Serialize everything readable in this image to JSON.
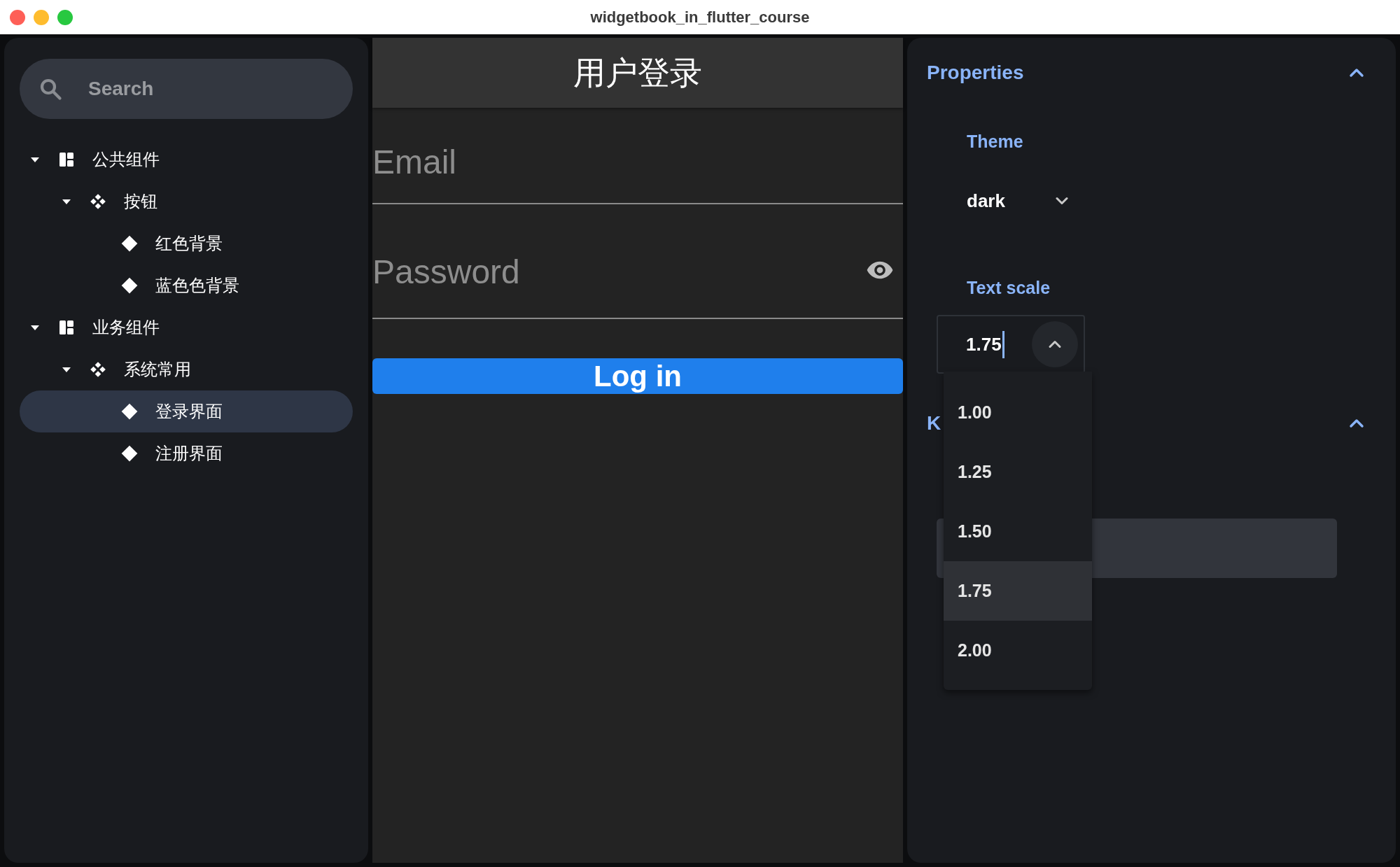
{
  "window": {
    "title": "widgetbook_in_flutter_course"
  },
  "sidebar": {
    "search": {
      "placeholder": "Search"
    },
    "tree": [
      {
        "label": "公共组件",
        "kind": "category",
        "expanded": true,
        "selected": false,
        "children": [
          {
            "label": "按钮",
            "kind": "component",
            "expanded": true,
            "selected": false,
            "children": [
              {
                "label": "红色背景",
                "kind": "use_case",
                "selected": false
              },
              {
                "label": "蓝色色背景",
                "kind": "use_case",
                "selected": false
              }
            ]
          }
        ]
      },
      {
        "label": "业务组件",
        "kind": "category",
        "expanded": true,
        "selected": false,
        "children": [
          {
            "label": "系统常用",
            "kind": "component",
            "expanded": true,
            "selected": false,
            "children": [
              {
                "label": "登录界面",
                "kind": "use_case",
                "selected": true
              },
              {
                "label": "注册界面",
                "kind": "use_case",
                "selected": false
              }
            ]
          }
        ]
      }
    ]
  },
  "preview": {
    "app_bar_title": "用户登录",
    "fields": [
      {
        "placeholder": "Email",
        "kind": "text"
      },
      {
        "placeholder": "Password",
        "kind": "password"
      }
    ],
    "button": "Log in"
  },
  "panel": {
    "sections": [
      {
        "title": "Properties",
        "expanded": true
      },
      {
        "title": "K",
        "expanded": true
      }
    ],
    "theme": {
      "label": "Theme",
      "value": "dark"
    },
    "text_scale": {
      "label": "Text scale",
      "value": "1.75",
      "open": true,
      "options": [
        {
          "label": "1.00",
          "selected": false
        },
        {
          "label": "1.25",
          "selected": false
        },
        {
          "label": "1.50",
          "selected": false
        },
        {
          "label": "1.75",
          "selected": true
        },
        {
          "label": "2.00",
          "selected": false
        }
      ]
    }
  }
}
